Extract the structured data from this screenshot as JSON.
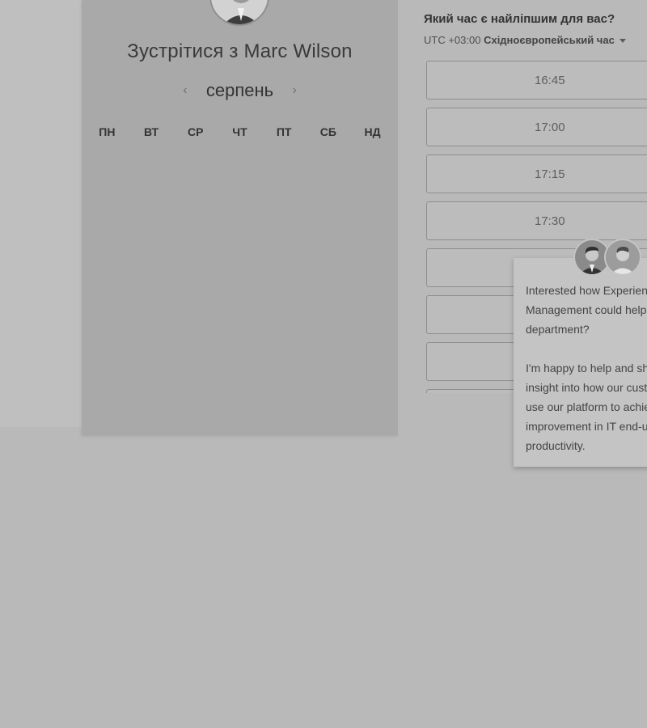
{
  "meeting": {
    "title": "Зустрітися з Marc Wilson",
    "month": "серпень",
    "prev_icon": "chevron-left-icon",
    "next_icon": "chevron-right-icon",
    "prev_glyph": "‹",
    "next_glyph": "›",
    "weekdays": [
      "ПН",
      "ВТ",
      "СР",
      "ЧТ",
      "ПТ",
      "СБ",
      "НД"
    ]
  },
  "times": {
    "heading": "Який час є найліпшим для вас?",
    "timezone_offset": "UTC +03:00",
    "timezone_name": "Східноєвропейський час",
    "slots": [
      "16:45",
      "17:00",
      "17:15",
      "17:30",
      "",
      "",
      "",
      ""
    ]
  },
  "chat": {
    "message": "Interested how Experience Management could help your IT department?\n\nI'm happy to help and share insight into how our customers use our platform to achieve improvement in IT end-user productivity."
  },
  "colors": {
    "overlay_background": "#b9b9b9",
    "calendar_panel": "#a9a9a9",
    "chat_card": "#c4c4c4"
  }
}
